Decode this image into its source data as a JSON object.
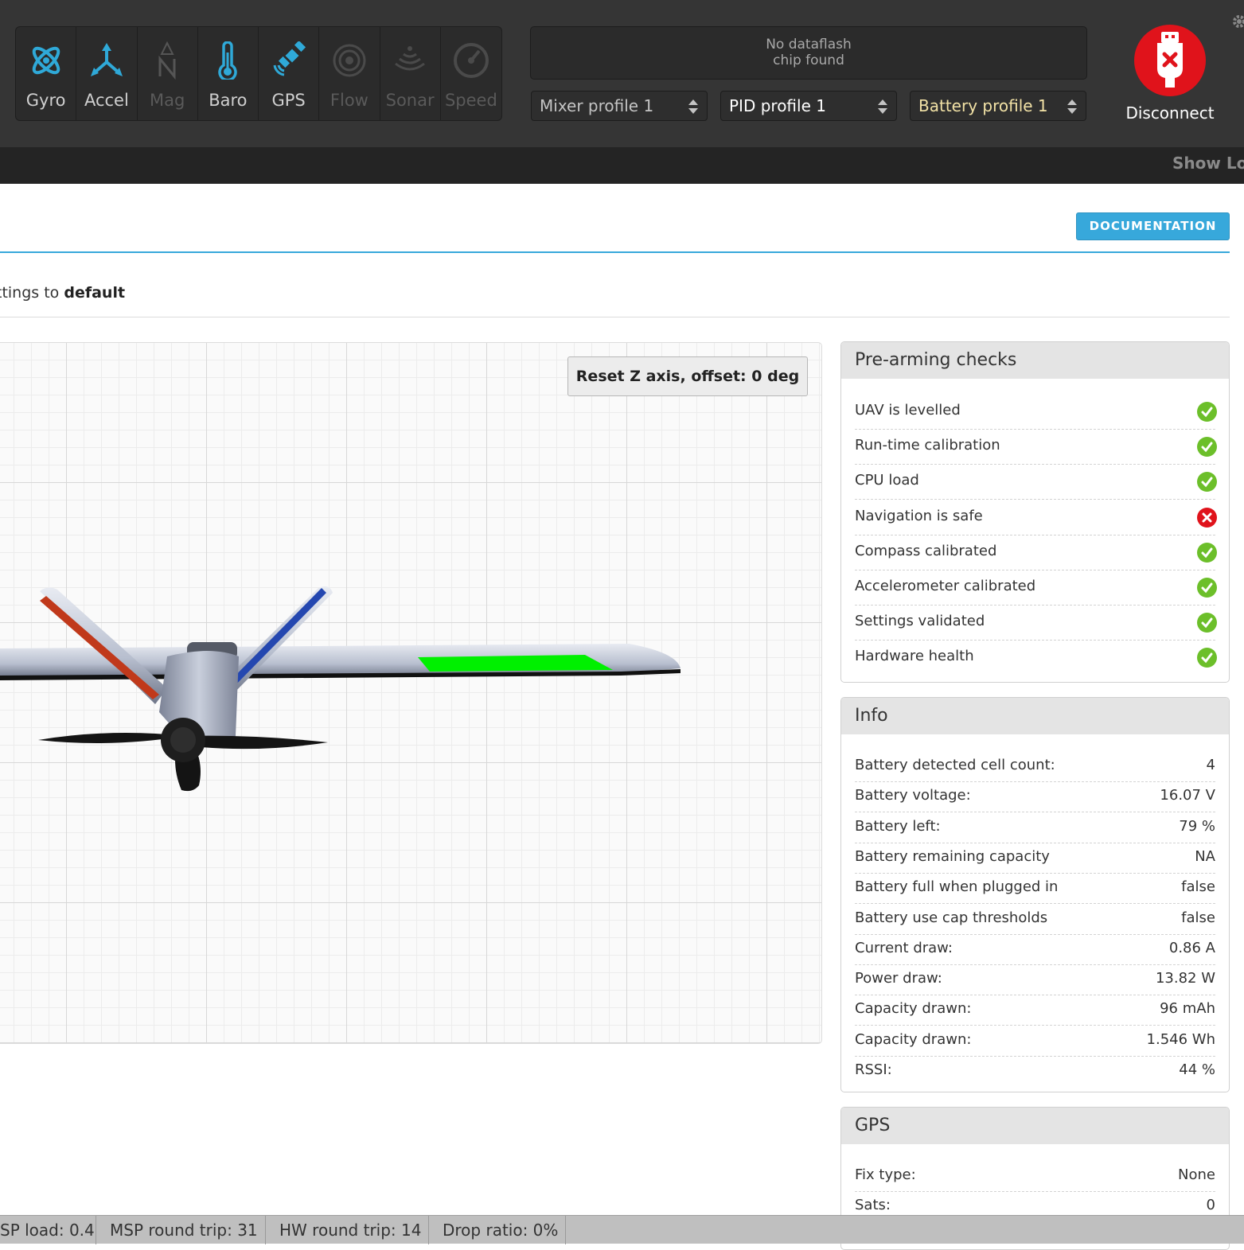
{
  "header": {
    "sensors": [
      {
        "label": "Gyro",
        "icon": "gyro-icon",
        "active": true
      },
      {
        "label": "Accel",
        "icon": "accel-icon",
        "active": true
      },
      {
        "label": "Mag",
        "icon": "mag-icon",
        "active": false
      },
      {
        "label": "Baro",
        "icon": "baro-icon",
        "active": true
      },
      {
        "label": "GPS",
        "icon": "gps-icon",
        "active": true
      },
      {
        "label": "Flow",
        "icon": "flow-icon",
        "active": false
      },
      {
        "label": "Sonar",
        "icon": "sonar-icon",
        "active": false
      },
      {
        "label": "Speed",
        "icon": "speed-icon",
        "active": false
      }
    ],
    "dataflash": {
      "line1": "No dataflash",
      "line2": "chip found"
    },
    "profiles": {
      "mixer": "Mixer profile 1",
      "pid": "PID profile 1",
      "battery": "Battery profile 1"
    },
    "disconnect_label": "Disconnect",
    "show_log": "Show Log"
  },
  "colors": {
    "accent": "#37a8db",
    "sensor_active": "#2fa9d8",
    "ok": "#6cbf2a",
    "fail": "#e0131b"
  },
  "content": {
    "documentation_label": "DOCUMENTATION",
    "reset_note_prefix": "ttings to ",
    "reset_note_bold": "default",
    "reset_z_label": "Reset Z axis, offset: 0 deg"
  },
  "prearm": {
    "title": "Pre-arming checks",
    "checks": [
      {
        "label": "UAV is levelled",
        "status": "ok"
      },
      {
        "label": "Run-time calibration",
        "status": "ok"
      },
      {
        "label": "CPU load",
        "status": "ok"
      },
      {
        "label": "Navigation is safe",
        "status": "fail"
      },
      {
        "label": "Compass calibrated",
        "status": "ok"
      },
      {
        "label": "Accelerometer calibrated",
        "status": "ok"
      },
      {
        "label": "Settings validated",
        "status": "ok"
      },
      {
        "label": "Hardware health",
        "status": "ok"
      }
    ]
  },
  "info": {
    "title": "Info",
    "rows": [
      {
        "label": "Battery detected cell count:",
        "value": "4"
      },
      {
        "label": "Battery voltage:",
        "value": "16.07 V"
      },
      {
        "label": "Battery left:",
        "value": "79 %"
      },
      {
        "label": "Battery remaining capacity",
        "value": "NA"
      },
      {
        "label": "Battery full when plugged in",
        "value": "false"
      },
      {
        "label": "Battery use cap thresholds",
        "value": "false"
      },
      {
        "label": "Current draw:",
        "value": "0.86 A"
      },
      {
        "label": "Power draw:",
        "value": "13.82 W"
      },
      {
        "label": "Capacity drawn:",
        "value": "96 mAh"
      },
      {
        "label": "Capacity drawn:",
        "value": "1.546 Wh"
      },
      {
        "label": "RSSI:",
        "value": "44 %"
      }
    ]
  },
  "gps": {
    "title": "GPS",
    "rows": [
      {
        "label": "Fix type:",
        "value": "None"
      },
      {
        "label": "Sats:",
        "value": "0"
      }
    ]
  },
  "statusbar": {
    "items": [
      "SP load: 0.4",
      "MSP round trip: 31",
      "HW round trip: 14",
      "Drop ratio: 0%"
    ]
  }
}
